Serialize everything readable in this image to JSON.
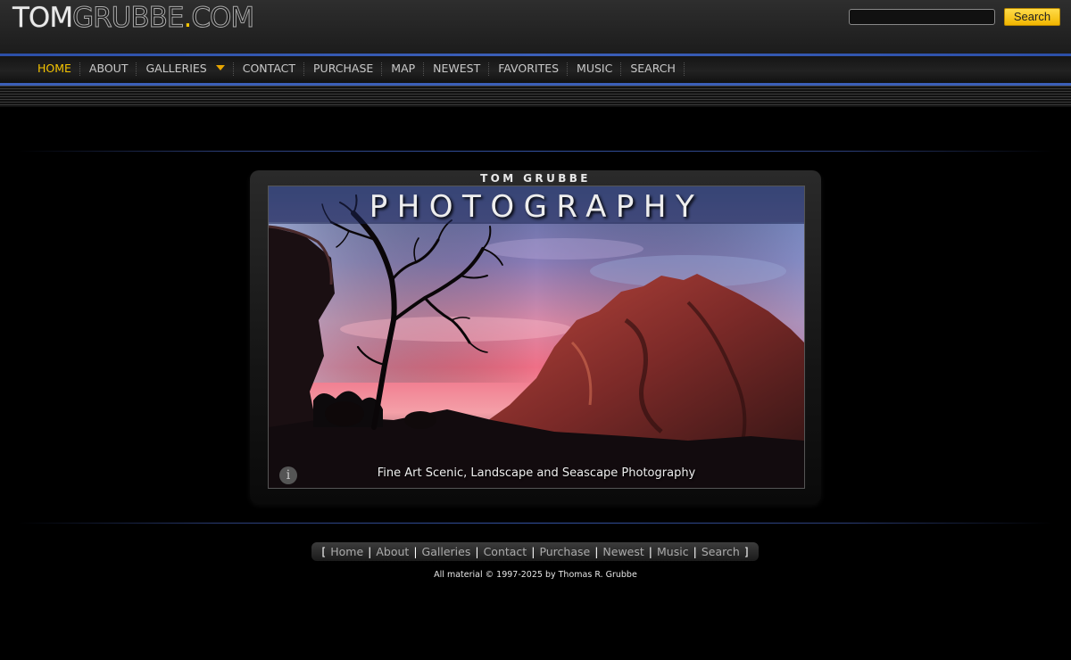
{
  "logo": {
    "part1": "TOM",
    "part2": "GRUBBE",
    "dot": ".",
    "part3": "COM"
  },
  "search": {
    "input_value": "",
    "button_label": "Search"
  },
  "nav": {
    "home": "HOME",
    "about": "ABOUT",
    "galleries": "GALLERIES",
    "contact": "CONTACT",
    "purchase": "PURCHASE",
    "map": "MAP",
    "newest": "NEWEST",
    "favorites": "FAVORITES",
    "music": "MUSIC",
    "search": "SEARCH",
    "active": "HOME"
  },
  "feature": {
    "kicker": "TOM GRUBBE",
    "title": "PHOTOGRAPHY",
    "caption": "Fine Art Scenic, Landscape and Seascape Photography",
    "info_icon_glyph": "i"
  },
  "footer": {
    "open_bracket": "[",
    "close_bracket": "]",
    "separator": "|",
    "links": {
      "home": "Home",
      "about": "About",
      "galleries": "Galleries",
      "contact": "Contact",
      "purchase": "Purchase",
      "newest": "Newest",
      "music": "Music",
      "search": "Search"
    },
    "copyright": "All material © 1997-2025 by Thomas R. Grubbe"
  },
  "colors": {
    "accent": "#f5c400",
    "nav_rule": "#3b5fb8",
    "background": "#000000"
  }
}
